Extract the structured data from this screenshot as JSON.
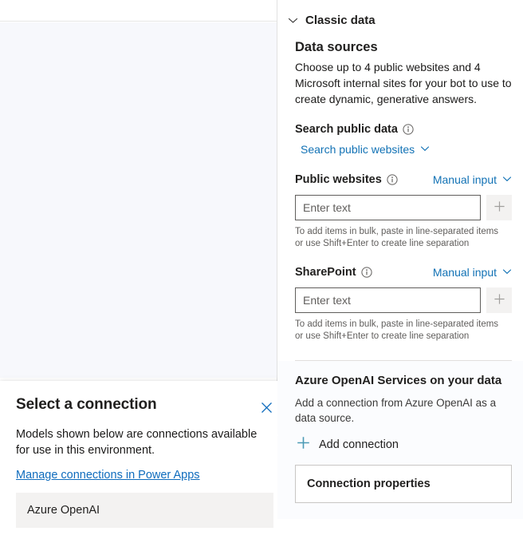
{
  "dialog": {
    "title": "Select a connection",
    "close_icon": "close-icon",
    "description": "Models shown below are connections available for use in this environment.",
    "manage_link": "Manage connections in Power Apps",
    "connections": [
      {
        "label": "Azure OpenAI"
      }
    ]
  },
  "right_panel": {
    "section": {
      "label": "Classic data",
      "chevron_icon": "chevron-down-icon"
    },
    "data_sources": {
      "title": "Data sources",
      "description": "Choose up to 4 public websites and 4 Microsoft internal sites for your bot to use to create dynamic, generative answers."
    },
    "search_public_data": {
      "label": "Search public data",
      "info_icon": "info-icon",
      "dropdown_label": "Search public websites",
      "dropdown_icon": "chevron-down-icon"
    },
    "public_websites": {
      "label": "Public websites",
      "info_icon": "info-icon",
      "mode_label": "Manual input",
      "mode_icon": "chevron-down-icon",
      "input_value": "",
      "input_placeholder": "Enter text",
      "add_icon": "plus-icon",
      "hint": "To add items in bulk, paste in line-separated items or use Shift+Enter to create line separation"
    },
    "sharepoint": {
      "label": "SharePoint",
      "info_icon": "info-icon",
      "mode_label": "Manual input",
      "mode_icon": "chevron-down-icon",
      "input_value": "",
      "input_placeholder": "Enter text",
      "add_icon": "plus-icon",
      "hint": "To add items in bulk, paste in line-separated items or use Shift+Enter to create line separation"
    },
    "azure_openai": {
      "title": "Azure OpenAI Services on your data",
      "description": "Add a connection from Azure OpenAI as a data source.",
      "add_connection_label": "Add connection",
      "add_connection_icon": "plus-icon",
      "connection_properties_label": "Connection properties"
    }
  },
  "colors": {
    "accent_blue": "#0f6cbd",
    "link_blue": "#1272b5",
    "plus_teal": "#4b9ab5",
    "text_primary": "#201f1e",
    "text_secondary": "#605e5c",
    "canvas_bg": "#f7f8fc",
    "list_bg": "#f3f2f1"
  }
}
